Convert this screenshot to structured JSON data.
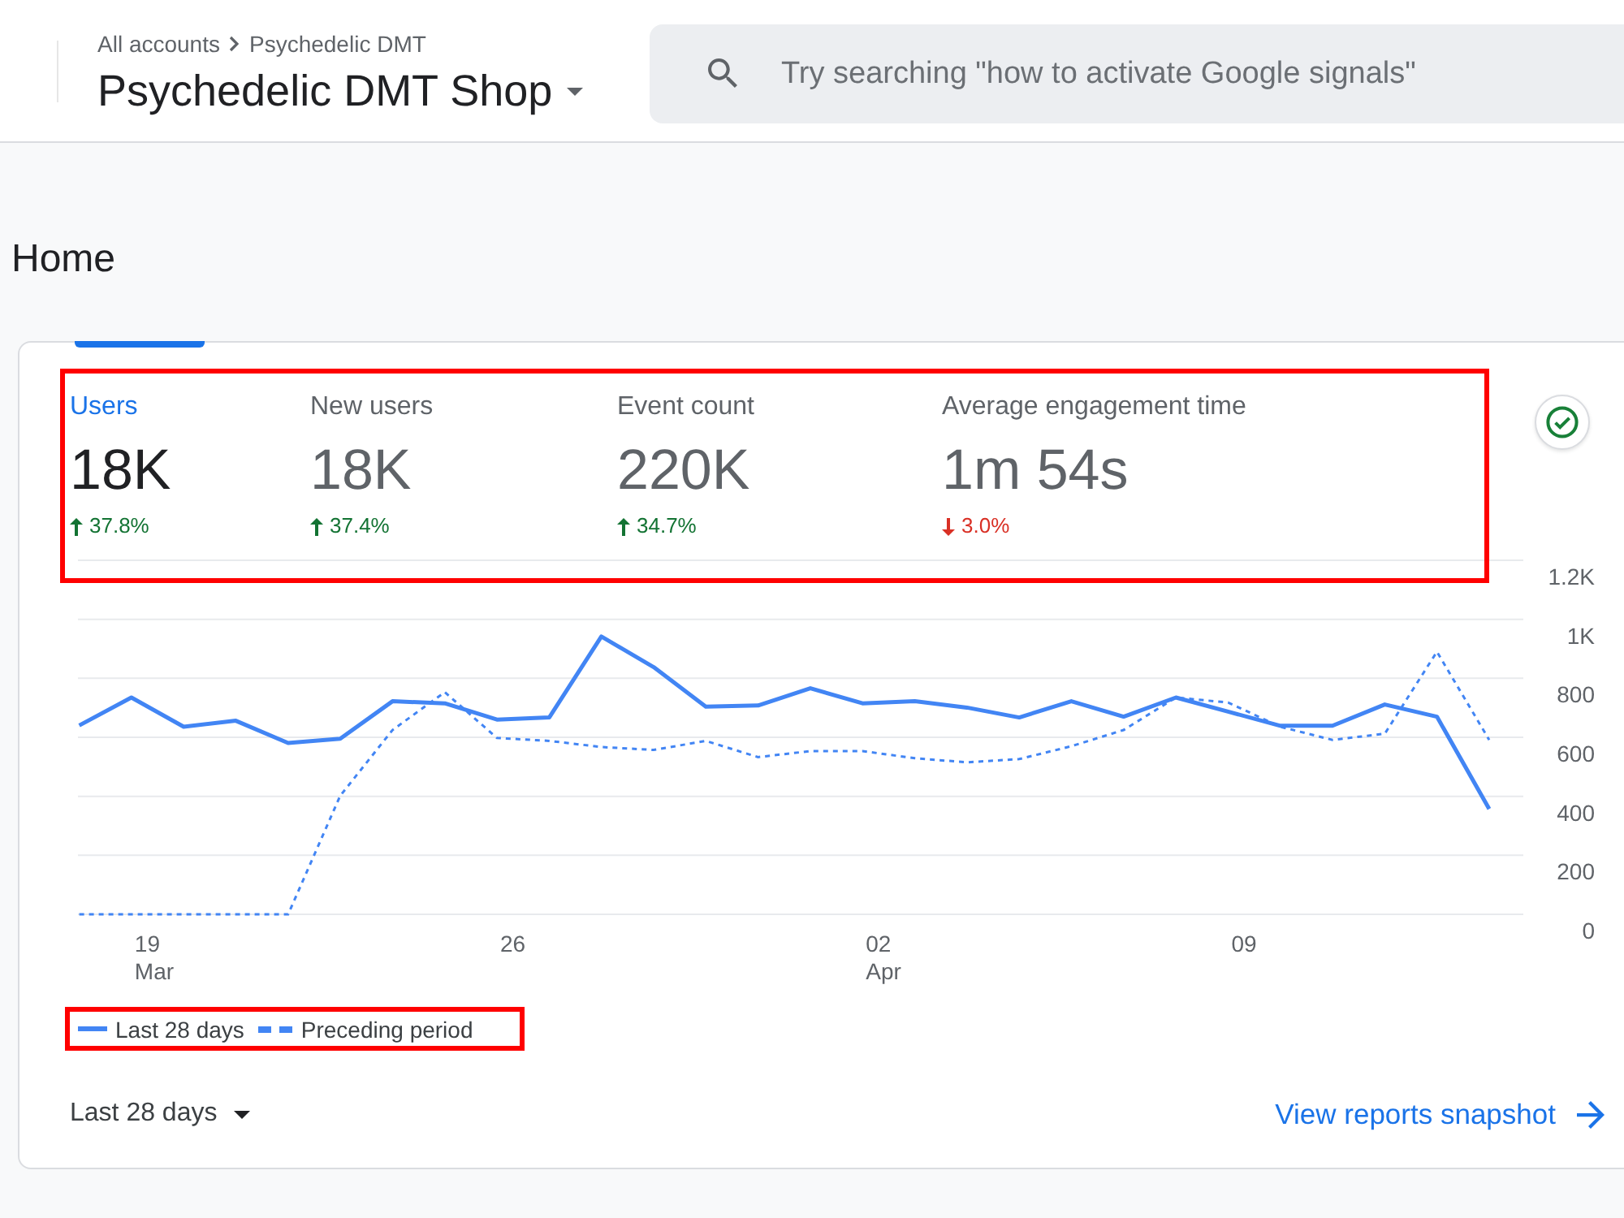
{
  "header": {
    "breadcrumb": [
      "All accounts",
      "Psychedelic DMT"
    ],
    "property_name": "Psychedelic DMT Shop",
    "search": {
      "placeholder": "Try searching \"how to activate Google signals\""
    }
  },
  "page_title": "Home",
  "card": {
    "metrics_highlighted": true,
    "metrics": [
      {
        "label": "Users",
        "value": "18K",
        "change": "37.8%",
        "kind": "increase",
        "selected": true
      },
      {
        "label": "New users",
        "value": "18K",
        "change": "37.4%",
        "kind": "increase",
        "selected": false
      },
      {
        "label": "Event count",
        "value": "220K",
        "change": "34.7%",
        "kind": "increase",
        "selected": false
      },
      {
        "label": "Average engagement time",
        "value": "1m 54s",
        "change": "3.0%",
        "kind": "decrease",
        "selected": false
      }
    ],
    "chart_data": {
      "type": "line",
      "grid": true,
      "categories": [
        null,
        "19\nMar",
        null,
        null,
        null,
        null,
        null,
        null,
        "26",
        null,
        null,
        null,
        null,
        null,
        null,
        "02\nApr",
        null,
        null,
        null,
        null,
        null,
        null,
        "09",
        null,
        null,
        null,
        null,
        null
      ],
      "ylim": [
        0,
        1200
      ],
      "yticks": [
        0,
        200,
        400,
        600,
        800,
        {
          "value": 1000,
          "label": "1K"
        },
        {
          "value": 1200,
          "label": "1.2K"
        }
      ],
      "series": [
        {
          "name": "Last 28 days",
          "color": "#4285f4",
          "line_style": "solid",
          "values": [
            640,
            735,
            636,
            656,
            581,
            595,
            722,
            715,
            660,
            667,
            942,
            838,
            704,
            708,
            766,
            715,
            722,
            701,
            667,
            722,
            670,
            735,
            687,
            639,
            639,
            711,
            670,
            357
          ]
        },
        {
          "name": "Preceding period",
          "color": "#4285f4",
          "line_style": "dashed",
          "values": [
            0,
            0,
            0,
            0,
            0,
            402,
            625,
            753,
            598,
            588,
            567,
            557,
            588,
            533,
            553,
            553,
            529,
            515,
            526,
            570,
            625,
            735,
            718,
            636,
            591,
            612,
            890,
            591
          ]
        }
      ]
    },
    "legend_highlighted": true,
    "date_range": "Last 28 days",
    "link": "View reports snapshot"
  }
}
